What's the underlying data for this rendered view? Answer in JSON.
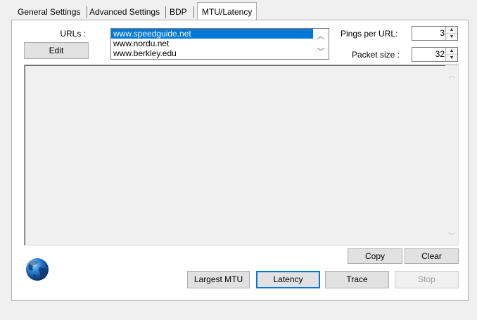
{
  "tabs": [
    {
      "label": "General Settings"
    },
    {
      "label": "Advanced Settings"
    },
    {
      "label": "BDP"
    },
    {
      "label": "MTU/Latency"
    }
  ],
  "urls": {
    "label": "URLs :",
    "edit_label": "Edit",
    "items": [
      "www.speedguide.net",
      "www.nordu.net",
      "www.berkley.edu"
    ],
    "selected": "www.speedguide.net"
  },
  "pings": {
    "label": "Pings per URL:",
    "value": "3"
  },
  "packet": {
    "label": "Packet size :",
    "value": "32"
  },
  "output": {
    "text": ""
  },
  "buttons": {
    "copy": "Copy",
    "clear": "Clear",
    "largest_mtu": "Largest MTU",
    "latency": "Latency",
    "trace": "Trace",
    "stop": "Stop"
  },
  "icons": {
    "globe": "globe-icon"
  }
}
